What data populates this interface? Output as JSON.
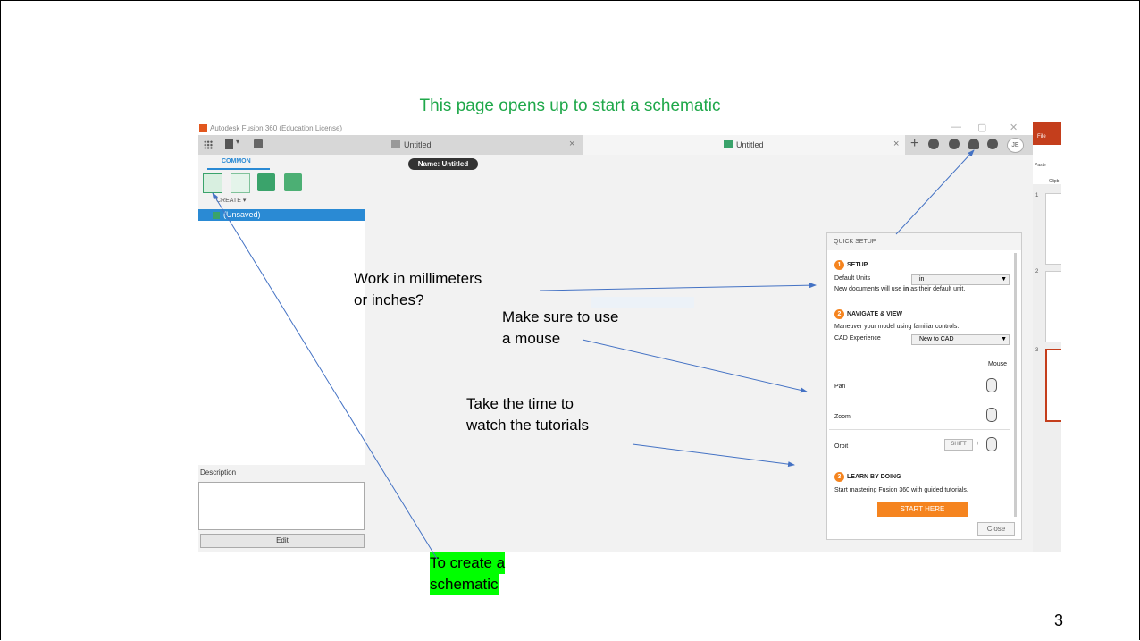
{
  "slide": {
    "title": "This page opens up to start a schematic",
    "number": "3"
  },
  "window": {
    "title": "Autodesk Fusion 360 (Education License)",
    "minimize": "—",
    "maximize": "▢",
    "close": "✕"
  },
  "tabs": [
    {
      "label": "Untitled"
    },
    {
      "label": "Untitled"
    }
  ],
  "tab_close": "×",
  "tab_add": "+",
  "user_initials": "JE",
  "document_name": "Name: Untitled",
  "toolbar": {
    "active_tab": "COMMON",
    "create_label": "CREATE ▾"
  },
  "browser": {
    "item": "(Unsaved)",
    "description_label": "Description",
    "edit_button": "Edit"
  },
  "quick_setup": {
    "header": "QUICK SETUP",
    "setup": {
      "num": "1",
      "heading": "SETUP",
      "units_label": "Default Units",
      "units_value": "in",
      "units_note_pre": "New documents will use ",
      "units_note_bold": "in",
      "units_note_post": " as their default unit."
    },
    "navigate": {
      "num": "2",
      "heading": "NAVIGATE & VIEW",
      "description": "Maneuver your model using familiar controls.",
      "cad_label": "CAD Experience",
      "cad_value": "New to CAD",
      "mouse_header": "Mouse",
      "pan": "Pan",
      "zoom": "Zoom",
      "orbit": "Orbit",
      "shift_key": "SHIFT",
      "plus": "+"
    },
    "learn": {
      "num": "3",
      "heading": "LEARN BY DOING",
      "description": "Start mastering Fusion 360 with guided tutorials.",
      "start_button": "START HERE"
    },
    "close_button": "Close"
  },
  "ppt": {
    "file": "File",
    "paste": "Paste",
    "clipboard": "Clipb",
    "slide_numbers": [
      "1",
      "2",
      "3"
    ]
  },
  "annotations": {
    "units_q_line1": "Work in millimeters",
    "units_q_line2": "or inches?",
    "mouse_line1": "Make sure to use",
    "mouse_line2": "a mouse",
    "tutorials_line1": "Take the time to",
    "tutorials_line2": "watch the tutorials",
    "schematic_line1": "To create a",
    "schematic_line2": "schematic"
  }
}
